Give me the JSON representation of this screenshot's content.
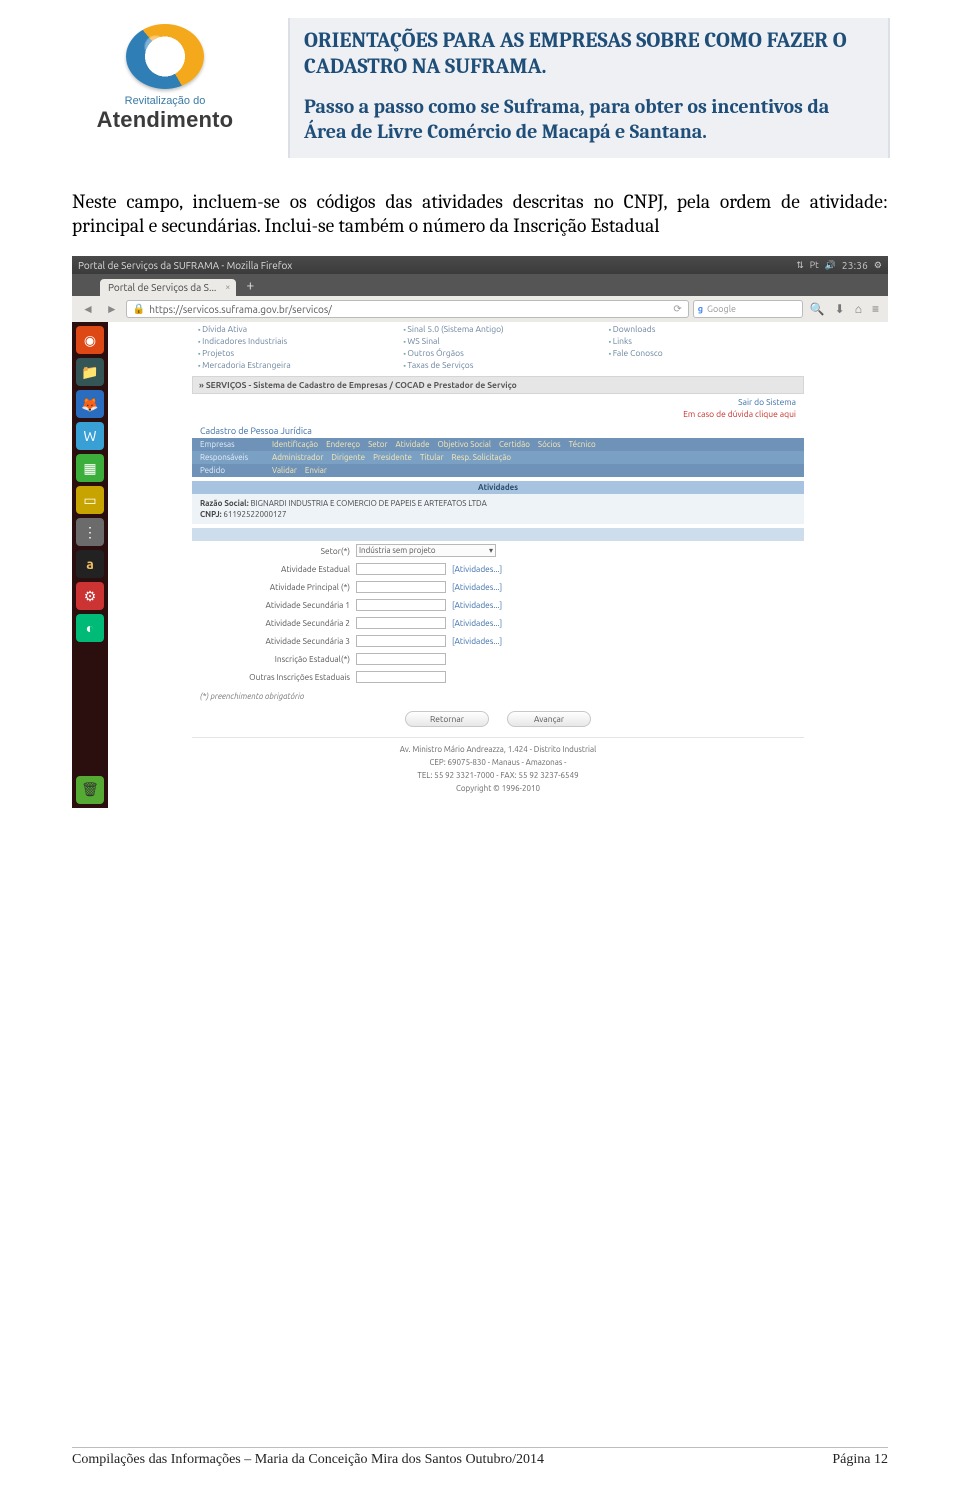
{
  "doc": {
    "logo": {
      "small": "Revitalização do",
      "big": "Atendimento"
    },
    "title1": "ORIENTAÇÕES PARA AS EMPRESAS SOBRE COMO FAZER O CADASTRO NA SUFRAMA.",
    "title2": "Passo a passo como se Suframa, para obter os incentivos da Área de Livre Comércio de Macapá e Santana.",
    "paragraph": "Neste campo, incluem-se os códigos das atividades descritas no CNPJ, pela ordem de atividade: principal e secundárias. Inclui-se também o número da Inscrição Estadual",
    "footer_left": "Compilações das Informações – Maria da Conceição Mira dos Santos  Outubro/2014",
    "footer_right": "Página 12"
  },
  "ff": {
    "window_title": "Portal de Serviços da SUFRAMA - Mozilla Firefox",
    "tab_label": "Portal de Serviços da S...",
    "url_host": "servicos.suframa.gov.br",
    "url_path": "/servicos/",
    "search_placeholder": "Google",
    "clock": "23:36",
    "status1": "Pt",
    "status2": "🔊"
  },
  "portal": {
    "top_links": {
      "col1": [
        "Dívida Ativa",
        "Indicadores Industriais",
        "Projetos",
        "Mercadoria Estrangeira"
      ],
      "col2": [
        "Sinal 5.0 (Sistema Antigo)",
        "WS Sinal",
        "Outros Órgãos",
        "Taxas de Serviços"
      ],
      "col3": [
        "Downloads",
        "Links",
        "Fale Conosco"
      ]
    },
    "grey_bar": "» SERVIÇOS - Sistema de Cadastro de Empresas / COCAD e Prestador de Serviço",
    "right_link1": "Sair do Sistema",
    "right_link2": "Em caso de dúvida clique aqui",
    "section_title": "Cadastro de Pessoa Jurídica",
    "nav": {
      "empresas": {
        "label": "Empresas",
        "items": [
          "Identificação",
          "Endereço",
          "Setor",
          "Atividade",
          "Objetivo Social",
          "Certidão",
          "Sócios",
          "Técnico"
        ]
      },
      "responsaveis": {
        "label": "Responsáveis",
        "items": [
          "Administrador",
          "Dirigente",
          "Presidente",
          "Titular",
          "Resp. Solicitação"
        ]
      },
      "pedido": {
        "label": "Pedido",
        "items": [
          "Validar",
          "Enviar"
        ]
      }
    },
    "ativ_header": "Atividades",
    "meta": {
      "razao_label": "Razão Social:",
      "razao_value": "BIGNARDI INDUSTRIA E COMERCIO DE PAPEIS E ARTEFATOS LTDA",
      "cnpj_label": "CNPJ:",
      "cnpj_value": "61192522000127"
    },
    "form": {
      "setor_label": "Setor(*)",
      "setor_value": "Indústria sem projeto",
      "rows": [
        {
          "label": "Atividade Estadual",
          "link": "[Atividades...]"
        },
        {
          "label": "Atividade Principal (*)",
          "link": "[Atividades...]"
        },
        {
          "label": "Atividade Secundária 1",
          "link": "[Atividades...]"
        },
        {
          "label": "Atividade Secundária 2",
          "link": "[Atividades...]"
        },
        {
          "label": "Atividade Secundária 3",
          "link": "[Atividades...]"
        }
      ],
      "inscricao_label": "Inscrição Estadual(*)",
      "outras_label": "Outras Inscrições Estaduais",
      "required_note": "(*) preenchimento obrigatório",
      "btn_back": "Retornar",
      "btn_next": "Avançar"
    },
    "footer": {
      "l1": "Av. Ministro Mário Andreazza, 1.424 - Distrito Industrial",
      "l2": "CEP: 69075-830 - Manaus - Amazonas -",
      "l3": "TEL: 55 92 3321-7000 - FAX: 55 92 3237-6549",
      "l4": "Copyright © 1996-2010"
    }
  }
}
